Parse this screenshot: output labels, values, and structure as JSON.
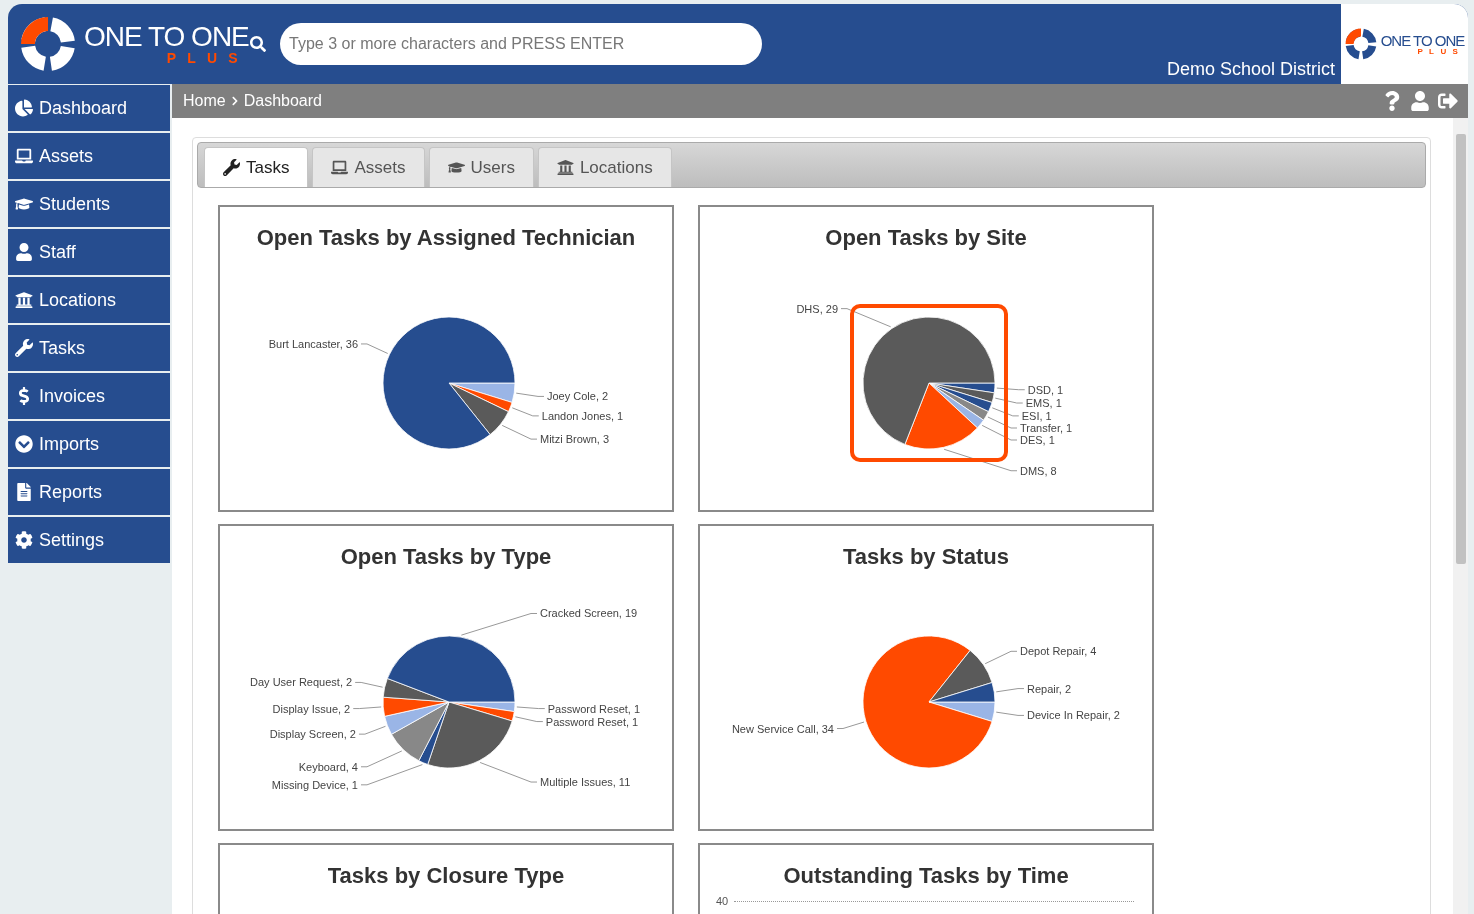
{
  "header": {
    "logo": {
      "name": "ONE TO ONE",
      "sub": "PLUS"
    },
    "search": {
      "placeholder": "Type 3 or more characters and PRESS ENTER"
    },
    "district": "Demo School District",
    "corner_logo": {
      "name": "ONE TO ONE",
      "sub": "PLUS"
    }
  },
  "sidebar": {
    "items": [
      {
        "label": "Dashboard"
      },
      {
        "label": "Assets"
      },
      {
        "label": "Students"
      },
      {
        "label": "Staff"
      },
      {
        "label": "Locations"
      },
      {
        "label": "Tasks"
      },
      {
        "label": "Invoices"
      },
      {
        "label": "Imports"
      },
      {
        "label": "Reports"
      },
      {
        "label": "Settings"
      }
    ]
  },
  "breadcrumb": [
    "Home",
    "Dashboard"
  ],
  "tabs": [
    {
      "label": "Tasks",
      "selected": true
    },
    {
      "label": "Assets",
      "selected": false
    },
    {
      "label": "Users",
      "selected": false
    },
    {
      "label": "Locations",
      "selected": false
    }
  ],
  "charts": [
    {
      "title": "Open Tasks by Assigned Technician",
      "highlighted": false,
      "chart_data": {
        "type": "pie",
        "values": [
          2,
          1,
          3,
          36
        ],
        "colors": [
          "#9ab5e6",
          "#ff4a00",
          "#5a5a5a",
          "#264d8f"
        ],
        "value_labels": [
          "Joey Cole, 2",
          "Landon Jones, 1",
          "Mitzi Brown, 3",
          "Burt Lancaster, 36"
        ]
      }
    },
    {
      "title": "Open Tasks by Site",
      "highlighted": true,
      "chart_data": {
        "type": "pie",
        "values": [
          1,
          1,
          1,
          1,
          1,
          8,
          29
        ],
        "colors": [
          "#264d8f",
          "#5a5a5a",
          "#264d8f",
          "#888888",
          "#9ab5e6",
          "#ff4a00",
          "#5a5a5a"
        ],
        "value_labels": [
          "DSD, 1",
          "EMS, 1",
          "ESI, 1",
          "Transfer, 1",
          "DES, 1",
          "DMS, 8",
          "DHS, 29"
        ]
      }
    },
    {
      "title": "Open Tasks by Type",
      "highlighted": false,
      "chart_data": {
        "type": "pie",
        "values": [
          1,
          1,
          11,
          1,
          4,
          2,
          2,
          2,
          19
        ],
        "colors": [
          "#9ab5e6",
          "#ff4a00",
          "#5a5a5a",
          "#264d8f",
          "#888888",
          "#9ab5e6",
          "#ff4a00",
          "#5a5a5a",
          "#264d8f"
        ],
        "value_labels": [
          "Password Reset, 1",
          "Password Reset, 1",
          "Multiple Issues, 11",
          "Missing Device, 1",
          "Keyboard, 4",
          "Display Screen, 2",
          "Display Issue, 2",
          "Day User Request, 2",
          "Cracked Screen, 19"
        ]
      }
    },
    {
      "title": "Tasks by Status",
      "highlighted": false,
      "chart_data": {
        "type": "pie",
        "values": [
          2,
          34,
          4,
          2
        ],
        "colors": [
          "#9ab5e6",
          "#ff4a00",
          "#5a5a5a",
          "#264d8f"
        ],
        "value_labels": [
          "Device In Repair, 2",
          "New Service Call, 34",
          "Depot Repair, 4",
          "Repair, 2"
        ]
      }
    }
  ],
  "more_cards": [
    {
      "title": "Tasks by Closure Type"
    },
    {
      "title": "Outstanding Tasks by Time",
      "axis_label": "40"
    }
  ]
}
